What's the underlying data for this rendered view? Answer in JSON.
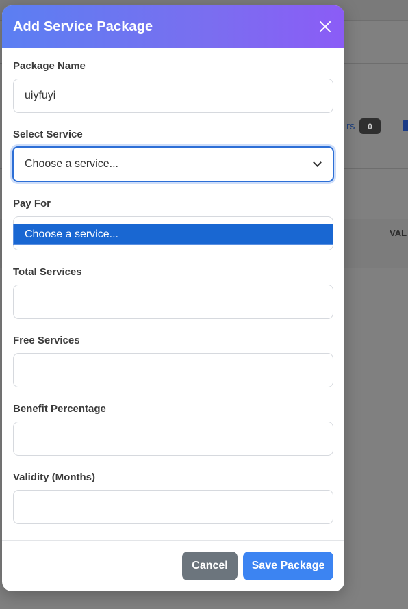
{
  "background": {
    "users_text": "rs",
    "users_count": "0",
    "column_header": "VAL"
  },
  "modal": {
    "title": "Add Service Package",
    "close_icon": "close-icon",
    "fields": {
      "package_name": {
        "label": "Package Name",
        "value": "uiyfuyi"
      },
      "select_service": {
        "label": "Select Service",
        "selected": "Choose a service...",
        "options": [
          "Choose a service..."
        ]
      },
      "pay_for": {
        "label": "Pay For",
        "value": ""
      },
      "total_services": {
        "label": "Total Services",
        "value": ""
      },
      "free_services": {
        "label": "Free Services",
        "value": ""
      },
      "benefit_percentage": {
        "label": "Benefit Percentage",
        "value": ""
      },
      "validity_months": {
        "label": "Validity (Months)",
        "value": ""
      }
    },
    "footer": {
      "cancel_label": "Cancel",
      "save_label": "Save Package"
    }
  },
  "colors": {
    "header_gradient_start": "#5b7ff2",
    "header_gradient_end": "#8b5cf6",
    "focus_border": "#2d6fd6",
    "dropdown_highlight": "#1967d2",
    "cancel_button": "#6c757d",
    "save_button": "#3c84f2"
  }
}
